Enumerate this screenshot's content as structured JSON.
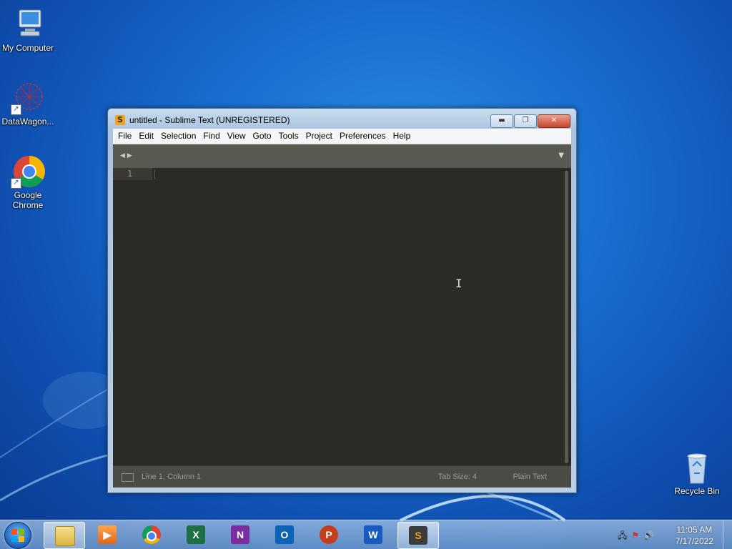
{
  "desktop": {
    "icons": [
      {
        "label": "My Computer"
      },
      {
        "label": "DataWagon..."
      },
      {
        "label": "Google Chrome"
      },
      {
        "label": "Recycle Bin"
      }
    ]
  },
  "window": {
    "title": "untitled - Sublime Text (UNREGISTERED)",
    "app_icon_letter": "S",
    "menu": [
      "File",
      "Edit",
      "Selection",
      "Find",
      "View",
      "Goto",
      "Tools",
      "Project",
      "Preferences",
      "Help"
    ],
    "editor": {
      "line_numbers": [
        "1"
      ]
    },
    "status": {
      "position": "Line 1, Column 1",
      "tab_size": "Tab Size: 4",
      "syntax": "Plain Text"
    }
  },
  "taskbar": {
    "apps": [
      {
        "name": "windows-explorer",
        "letter": ""
      },
      {
        "name": "media-player",
        "letter": ""
      },
      {
        "name": "chrome",
        "letter": ""
      },
      {
        "name": "excel",
        "letter": "X"
      },
      {
        "name": "onenote",
        "letter": "N"
      },
      {
        "name": "outlook",
        "letter": "O"
      },
      {
        "name": "powerpoint",
        "letter": "P"
      },
      {
        "name": "word",
        "letter": "W"
      },
      {
        "name": "sublime-text",
        "letter": "S"
      }
    ],
    "clock": {
      "time": "11:05 AM",
      "date": "7/17/2022"
    }
  },
  "colors": {
    "editor_bg": "#2b2b25",
    "accent_sublime": "#f2a11a"
  }
}
